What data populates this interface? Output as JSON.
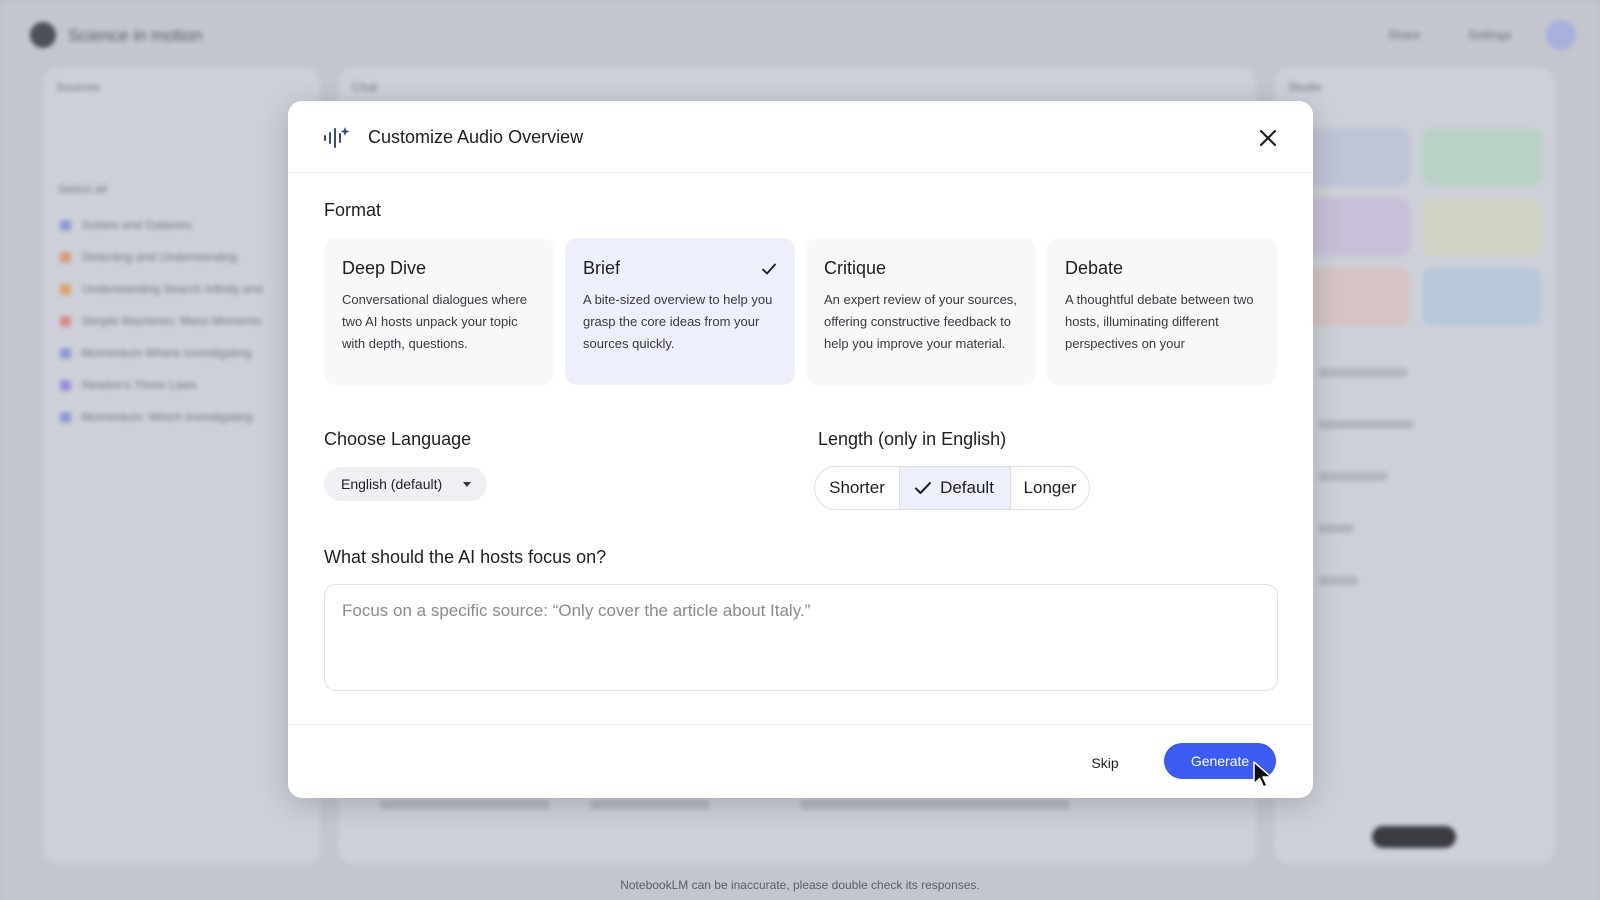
{
  "background": {
    "app_title": "Science in motion",
    "header_actions": [
      "Share",
      "Settings"
    ],
    "panels": {
      "left_title": "Sources",
      "middle_title": "Chat",
      "right_title": "Studio"
    },
    "left_items": [
      "Select all",
      "Solaris and Galaxies",
      "Detecting and Understanding",
      "Understanding Search Infinity and",
      "Simple Machines: Mass Moments",
      "Momentum Where Investigating",
      "Newton's Three Laws",
      "Momentum: Which Investigating"
    ]
  },
  "modal": {
    "title": "Customize Audio Overview",
    "format": {
      "label": "Format",
      "options": [
        {
          "name": "Deep Dive",
          "description": "Conversational dialogues where two AI hosts unpack your topic with depth, questions.",
          "selected": false
        },
        {
          "name": "Brief",
          "description": "A bite-sized overview to help you grasp the core ideas from your sources quickly.",
          "selected": true
        },
        {
          "name": "Critique",
          "description": "An expert review of your sources, offering constructive feedback to help you improve your material.",
          "selected": false
        },
        {
          "name": "Debate",
          "description": "A thoughtful debate between two hosts, illuminating different perspectives on your",
          "selected": false
        }
      ]
    },
    "language": {
      "label": "Choose Language",
      "selected": "English (default)"
    },
    "length": {
      "label": "Length (only in English)",
      "options": [
        "Shorter",
        "Default",
        "Longer"
      ],
      "selected": "Default"
    },
    "focus": {
      "label": "What should the AI hosts focus on?",
      "placeholder": "Focus on a specific source: “Only cover the article about Italy.”",
      "value": ""
    },
    "actions": {
      "skip": "Skip",
      "generate": "Generate"
    }
  },
  "disclaimer": "NotebookLM can be inaccurate, please double check its responses.",
  "colors": {
    "accent": "#3b5bf2",
    "selected_card": "#edeffa",
    "card": "#f7f8fa"
  }
}
